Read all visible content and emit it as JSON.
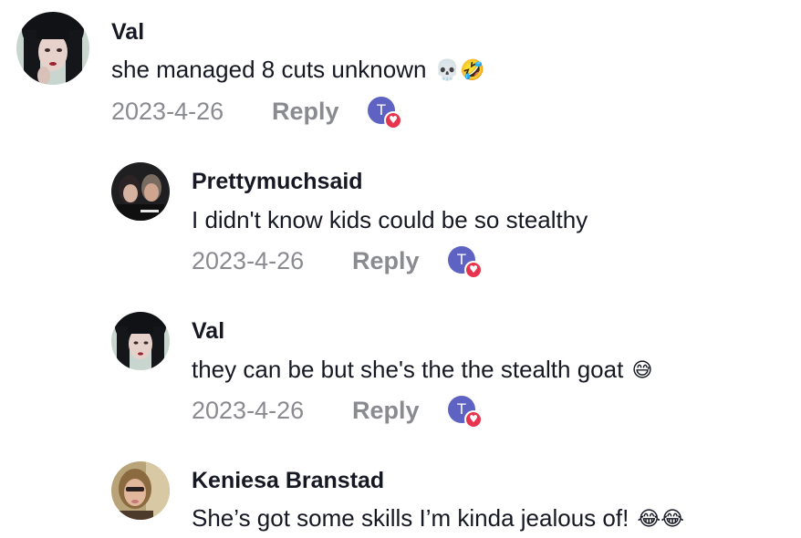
{
  "comments": [
    {
      "username": "Val",
      "text": "she managed 8 cuts unknown",
      "emoji": "💀🤣",
      "date": "2023-4-26",
      "reply_label": "Reply",
      "liker_initial": "T"
    },
    {
      "username": "Prettymuchsaid",
      "text": "I didn't know kids could be so stealthy",
      "emoji": "",
      "date": "2023-4-26",
      "reply_label": "Reply",
      "liker_initial": "T"
    },
    {
      "username": "Val",
      "text": "they can be but she's the the stealth goat",
      "emoji": "😅",
      "date": "2023-4-26",
      "reply_label": "Reply",
      "liker_initial": "T"
    },
    {
      "username": "Keniesa Branstad",
      "text": "She’s got some skills I’m kinda jealous of!",
      "emoji": "😂😂",
      "date": "",
      "reply_label": "",
      "liker_initial": ""
    }
  ],
  "colors": {
    "text": "#161823",
    "muted": "#8a8b91",
    "liker_bubble": "#5d62c3",
    "heart": "#e8354f"
  }
}
